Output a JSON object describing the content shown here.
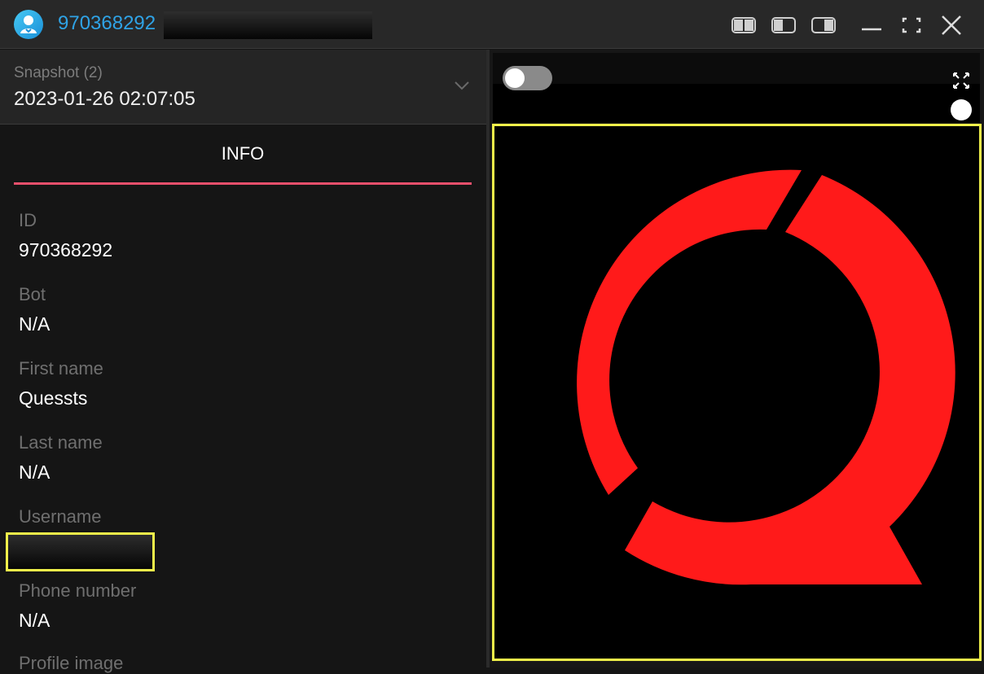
{
  "window": {
    "title_id": "970368292",
    "controls": [
      "layout-left-icon",
      "layout-center-icon",
      "layout-right-icon",
      "minimize-icon",
      "maximize-icon",
      "close-icon"
    ]
  },
  "snapshot": {
    "label": "Snapshot (2)",
    "value": "2023-01-26 02:07:05"
  },
  "tabs": {
    "info": "INFO"
  },
  "fields": {
    "id": {
      "label": "ID",
      "value": "970368292"
    },
    "bot": {
      "label": "Bot",
      "value": "N/A"
    },
    "first_name": {
      "label": "First name",
      "value": "Quessts"
    },
    "last_name": {
      "label": "Last name",
      "value": "N/A"
    },
    "username": {
      "label": "Username",
      "value": ""
    },
    "phone": {
      "label": "Phone number",
      "value": "N/A"
    },
    "profile_image": {
      "label": "Profile image"
    }
  },
  "colors": {
    "accent_blue": "#2fa3e6",
    "tab_underline": "#e9506c",
    "highlight": "#f1f24a",
    "logo_red": "#ff1a1a"
  }
}
